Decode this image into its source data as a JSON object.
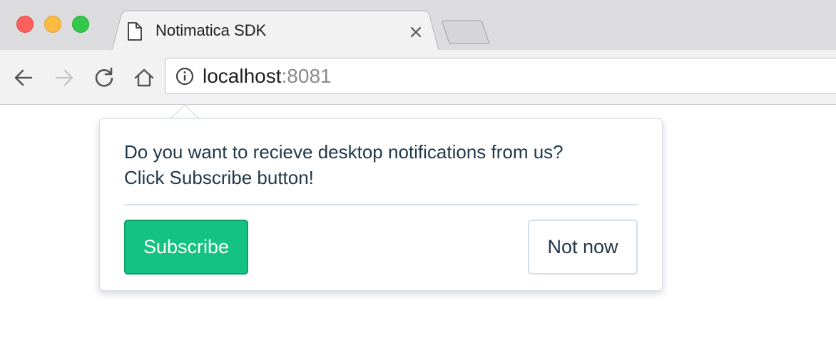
{
  "window": {
    "traffic_lights": {
      "close_color": "#fc605c",
      "minimize_color": "#fdbc40",
      "maximize_color": "#34c84a"
    }
  },
  "tab": {
    "title": "Notimatica SDK",
    "icon": "document-icon",
    "close_icon": "close-icon"
  },
  "toolbar": {
    "back_icon": "arrow-left-icon",
    "forward_icon": "arrow-right-icon",
    "reload_icon": "reload-icon",
    "home_icon": "home-icon",
    "info_icon": "info-icon",
    "url_host": "localhost",
    "url_port": ":8081"
  },
  "popover": {
    "message_line1": "Do you want to recieve desktop notifications from us?",
    "message_line2": "Click Subscribe button!",
    "subscribe_label": "Subscribe",
    "not_now_label": "Not now",
    "accent_color": "#14c384"
  }
}
